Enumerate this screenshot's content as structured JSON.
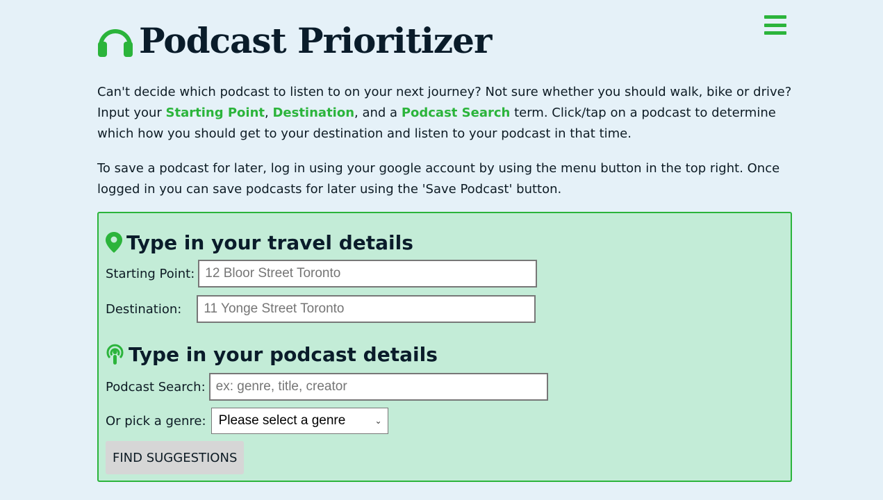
{
  "app": {
    "title": "Podcast Prioritizer",
    "accent_color": "#2bb43b",
    "panel_color": "#c3ecd7",
    "background_color": "#e5f1f8"
  },
  "header": {
    "logo_icon": "headphones-icon",
    "menu_icon": "hamburger-menu-icon"
  },
  "intro": {
    "p1_part1": "Can't decide which podcast to listen to on your next journey? Not sure whether you should walk, bike or drive? Input your ",
    "hl_start": "Starting Point",
    "sep1": ", ",
    "hl_dest": "Destination",
    "sep2": ", and a ",
    "hl_search": "Podcast Search",
    "p1_part2": " term. Click/tap on a podcast to determine which how you should get to your destination and listen to your podcast in that time.",
    "p2": "To save a podcast for later, log in using your google account by using the menu button in the top right. Once logged in you can save podcasts for later using the 'Save Podcast' button."
  },
  "travel": {
    "icon": "map-pin-icon",
    "title": "Type in your travel details",
    "start_label": "Starting Point:",
    "start_placeholder": "12 Bloor Street Toronto",
    "dest_label": "Destination:",
    "dest_placeholder": "11 Yonge Street Toronto"
  },
  "podcast": {
    "icon": "podcast-icon",
    "title": "Type in your podcast details",
    "search_label": "Podcast Search:",
    "search_placeholder": "ex: genre, title, creator",
    "genre_label": "Or pick a genre:",
    "genre_selected": "Please select a genre",
    "button_label": "FIND SUGGESTIONS"
  }
}
